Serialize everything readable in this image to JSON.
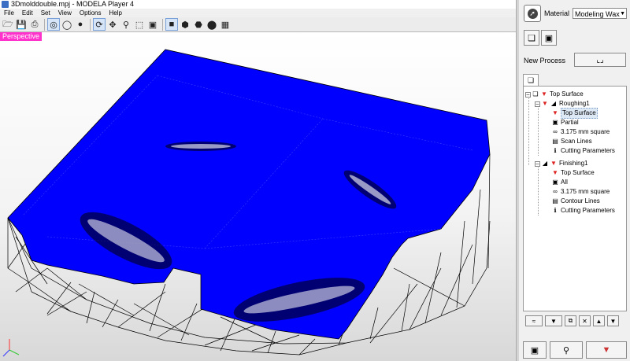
{
  "window": {
    "title": "3Dmolddouble.mpj - MODELA Player 4"
  },
  "menu": [
    "File",
    "Edit",
    "Set",
    "View",
    "Options",
    "Help"
  ],
  "toolbar": {
    "icons": [
      "open-icon",
      "save-icon",
      "print-icon",
      "globe-icon",
      "globe-grid-icon",
      "sphere-icon",
      "rotate-icon",
      "move-icon",
      "zoom-icon",
      "fit-icon",
      "zoom-box-icon",
      "view-top-icon",
      "view-front-icon",
      "view-right-icon",
      "view-iso-icon",
      "view-grid-icon"
    ]
  },
  "viewport": {
    "mode_label": "Perspective",
    "colors": {
      "surface": "#0000ff",
      "wireframe": "#000000",
      "label_bg": "#ff33cc"
    }
  },
  "panel": {
    "material_label": "Material",
    "material_value": "Modeling Wax",
    "new_process_label": "New Process",
    "tree": [
      {
        "label": "Top Surface",
        "icon": "surface-icon",
        "level": 0
      },
      {
        "label": "Roughing1",
        "icon": "roughing-icon",
        "level": 1
      },
      {
        "label": "Top Surface",
        "icon": "surface-icon",
        "level": 2,
        "selected": true
      },
      {
        "label": "Partial",
        "icon": "partial-icon",
        "level": 2
      },
      {
        "label": "3.175 mm square",
        "icon": "tool-icon",
        "level": 2
      },
      {
        "label": "Scan Lines",
        "icon": "scan-lines-icon",
        "level": 2
      },
      {
        "label": "Cutting Parameters",
        "icon": "info-icon",
        "level": 2
      },
      {
        "label": "Finishing1",
        "icon": "finishing-icon",
        "level": 1
      },
      {
        "label": "Top Surface",
        "icon": "surface-icon",
        "level": 2
      },
      {
        "label": "All",
        "icon": "partial-icon",
        "level": 2
      },
      {
        "label": "3.175 mm square",
        "icon": "tool-icon",
        "level": 2
      },
      {
        "label": "Contour Lines",
        "icon": "contour-lines-icon",
        "level": 2
      },
      {
        "label": "Cutting Parameters",
        "icon": "info-icon",
        "level": 2
      }
    ]
  }
}
